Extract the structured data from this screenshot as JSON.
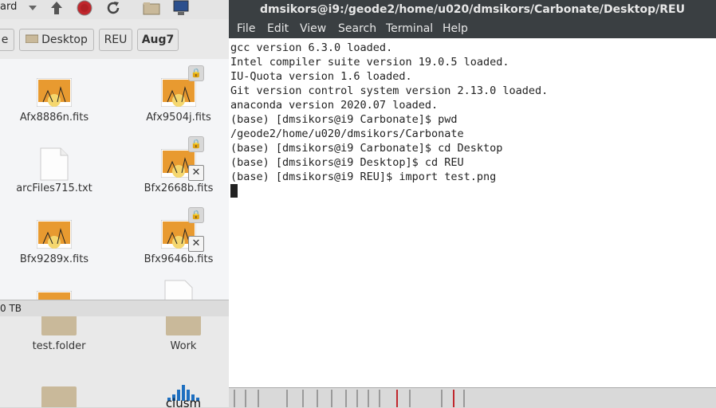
{
  "file_manager": {
    "toolbar_text": "ard",
    "breadcrumbs": [
      "e",
      "Desktop",
      "REU",
      "Aug7"
    ],
    "files": [
      {
        "name": "Afx8886n.fits",
        "type": "fits",
        "locked": false,
        "broken": false
      },
      {
        "name": "Afx9504j.fits",
        "type": "fits",
        "locked": true,
        "broken": false
      },
      {
        "name": "arcFiles715.txt",
        "type": "txt",
        "locked": false,
        "broken": false
      },
      {
        "name": "Bfx2668b.fits",
        "type": "fits",
        "locked": true,
        "broken": true
      },
      {
        "name": "Bfx9289x.fits",
        "type": "fits",
        "locked": false,
        "broken": false
      },
      {
        "name": "Bfx9646b.fits",
        "type": "fits",
        "locked": true,
        "broken": true
      }
    ],
    "status": "0 TB",
    "desktop_items": [
      {
        "name": "test.folder",
        "icon": "folder-icon"
      },
      {
        "name": "Work",
        "icon": "folder-icon"
      },
      {
        "name": "",
        "icon": "folder-icon"
      },
      {
        "name": "clusm",
        "icon": "app-icon"
      }
    ]
  },
  "terminal": {
    "title": "dmsikors@i9:/geode2/home/u020/dmsikors/Carbonate/Desktop/REU",
    "menu": [
      "File",
      "Edit",
      "View",
      "Search",
      "Terminal",
      "Help"
    ],
    "lines": [
      "gcc version 6.3.0 loaded.",
      "Intel compiler suite version 19.0.5 loaded.",
      "IU-Quota version 1.6 loaded.",
      "Git version control system version 2.13.0 loaded.",
      "anaconda version 2020.07 loaded.",
      "(base) [dmsikors@i9 Carbonate]$ pwd",
      "/geode2/home/u020/dmsikors/Carbonate",
      "(base) [dmsikors@i9 Carbonate]$ cd Desktop",
      "(base) [dmsikors@i9 Desktop]$ cd REU",
      "(base) [dmsikors@i9 REU]$ import test.png"
    ]
  },
  "colors": {
    "terminal_bg": "#ffffff",
    "titlebar": "#3a3f42",
    "accent_red": "#c0272d"
  }
}
